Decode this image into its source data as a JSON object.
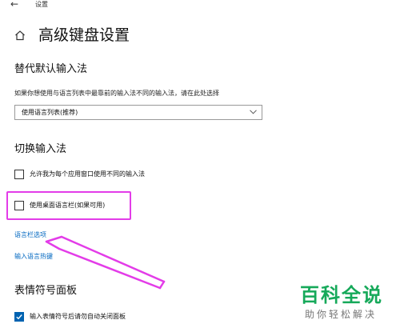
{
  "window": {
    "title": "设置"
  },
  "header": {
    "title": "高级键盘设置"
  },
  "override": {
    "title": "替代默认输入法",
    "description": "如果你想使用与语言列表中最靠前的输入法不同的输入法，请在此处选择",
    "dropdown_value": "使用语言列表(推荐)"
  },
  "switching": {
    "title": "切换输入法",
    "checkbox_per_app": {
      "label": "允许我为每个应用窗口使用不同的输入法",
      "checked": false
    },
    "checkbox_desktop_bar": {
      "label": "使用桌面语言栏(如果可用)",
      "checked": false
    },
    "link_language_bar_options": "语言栏选项",
    "link_hotkeys": "输入语言热键"
  },
  "emoji": {
    "title": "表情符号面板",
    "checkbox_auto_close": {
      "label": "输入表情符号后请勿自动关闭面板",
      "checked": true
    }
  },
  "watermark": {
    "main": "百科全说",
    "sub": "助你轻松解决"
  },
  "colors": {
    "accent": "#0067c0",
    "highlight": "#e33ce8",
    "watermark": "#16a95a"
  }
}
